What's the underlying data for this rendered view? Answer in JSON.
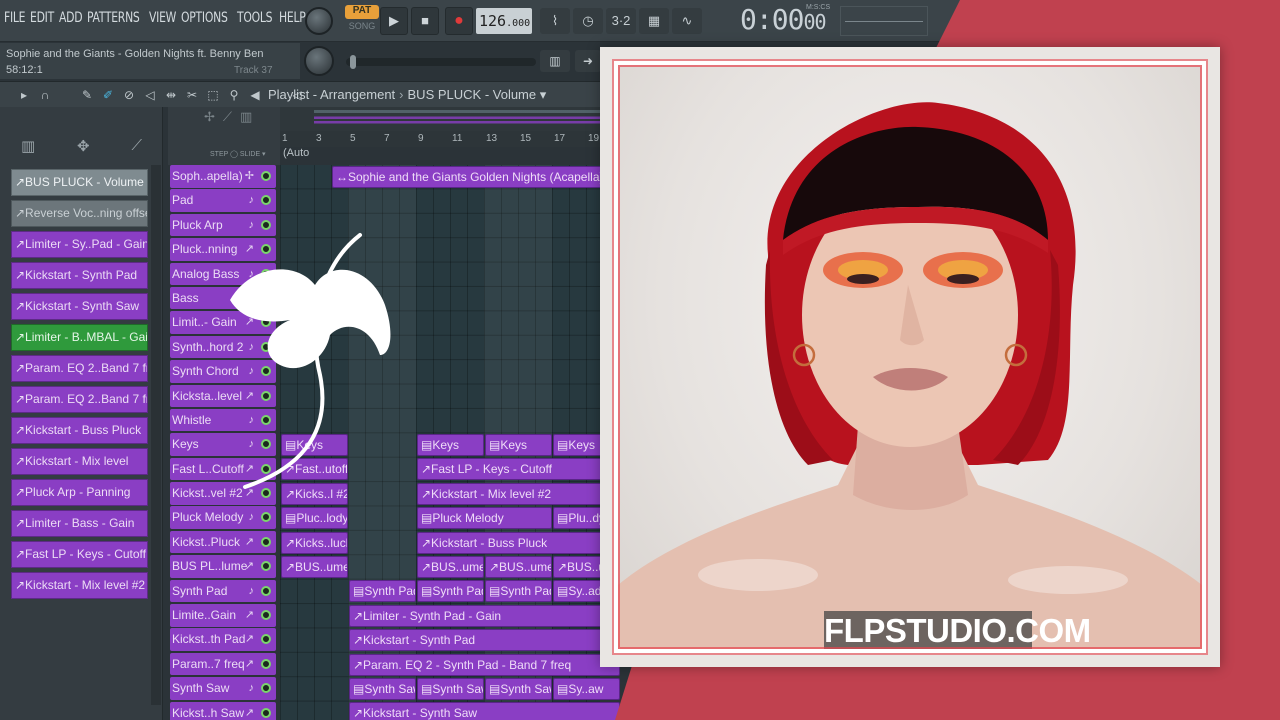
{
  "menu": [
    "FILE",
    "EDIT",
    "ADD",
    "PATTERNS",
    "VIEW",
    "OPTIONS",
    "TOOLS",
    "HELP"
  ],
  "transport": {
    "pat_label": "PAT",
    "song_label": "SONG",
    "play_icon": "play-icon",
    "stop_icon": "stop-icon",
    "record_icon": "record-icon",
    "tempo_main": "126",
    "tempo_frac": ".000",
    "clock": "0:00",
    "clock_frac": "00",
    "clock_label": "M:S:CS"
  },
  "toolbar_icons": [
    "snap-icon",
    "metronome-icon",
    "step-icon",
    "mixer-icon",
    "waveform-icon"
  ],
  "toolbar_glyphs": [
    "⌇",
    "◷",
    "3·2",
    "▦",
    "∿"
  ],
  "hint": {
    "title": "Sophie and the Giants - Golden Nights ft. Benny Ben",
    "time": "58:12:1",
    "track": "Track 37"
  },
  "breadcrumb": {
    "a": "Playlist - Arrangement",
    "sep": "›",
    "b": "BUS PLUCK - Volume",
    "c": "▾"
  },
  "picker": {
    "icons": [
      "▥",
      "✥",
      "⟋"
    ],
    "items": [
      {
        "label": "↗BUS PLUCK - Volume",
        "style": "sel"
      },
      {
        "label": "↗Reverse Voc..ning offset",
        "style": "gray"
      },
      {
        "label": "↗Limiter - Sy..Pad - Gain",
        "style": ""
      },
      {
        "label": "↗Kickstart - Synth Pad",
        "style": ""
      },
      {
        "label": "↗Kickstart - Synth Saw",
        "style": ""
      },
      {
        "label": "↗Limiter - B..MBAL - Gain",
        "style": "green"
      },
      {
        "label": "↗Param. EQ 2..Band 7 freq",
        "style": ""
      },
      {
        "label": "↗Param. EQ 2..Band 7 freq",
        "style": ""
      },
      {
        "label": "↗Kickstart - Buss Pluck",
        "style": ""
      },
      {
        "label": "↗Kickstart - Mix level",
        "style": ""
      },
      {
        "label": "↗Pluck Arp - Panning",
        "style": ""
      },
      {
        "label": "↗Limiter - Bass - Gain",
        "style": ""
      },
      {
        "label": "↗Fast LP - Keys - Cutoff",
        "style": ""
      },
      {
        "label": "↗Kickstart - Mix level #2",
        "style": ""
      }
    ]
  },
  "step_slide": "STEP ◯ SLIDE ▾",
  "tracks": [
    {
      "label": "Soph..apella)",
      "icon": "✢"
    },
    {
      "label": "Pad",
      "icon": "♪"
    },
    {
      "label": "Pluck Arp",
      "icon": "♪"
    },
    {
      "label": "Pluck..nning",
      "icon": "↗"
    },
    {
      "label": "Analog Bass",
      "icon": "♪"
    },
    {
      "label": "Bass",
      "icon": "♪"
    },
    {
      "label": "Limit..- Gain",
      "icon": "↗"
    },
    {
      "label": "Synth..hord 2",
      "icon": "♪"
    },
    {
      "label": "Synth Chord",
      "icon": "♪"
    },
    {
      "label": "Kicksta..level",
      "icon": "↗"
    },
    {
      "label": "Whistle",
      "icon": "♪"
    },
    {
      "label": "Keys",
      "icon": "♪"
    },
    {
      "label": "Fast L..Cutoff",
      "icon": "↗"
    },
    {
      "label": "Kickst..vel #2",
      "icon": "↗"
    },
    {
      "label": "Pluck Melody",
      "icon": "♪"
    },
    {
      "label": "Kickst..Pluck",
      "icon": "↗"
    },
    {
      "label": "BUS PL..lume",
      "icon": "↗"
    },
    {
      "label": "Synth Pad",
      "icon": "♪"
    },
    {
      "label": "Limite..Gain",
      "icon": "↗"
    },
    {
      "label": "Kickst..th Pad",
      "icon": "↗"
    },
    {
      "label": "Param..7 freq",
      "icon": "↗"
    },
    {
      "label": "Synth Saw",
      "icon": "♪"
    },
    {
      "label": "Kickst..h Saw",
      "icon": "↗"
    }
  ],
  "ruler": [
    "1",
    "3",
    "5",
    "7",
    "9",
    "11",
    "13",
    "15",
    "17",
    "19"
  ],
  "auto_label": "(Auto",
  "clips": [
    {
      "row": 0,
      "col": 3,
      "span": 16,
      "label": "↔Sophie and the Giants  Golden Nights (Acapella)"
    },
    {
      "row": 11,
      "col": 0,
      "span": 4,
      "label": "▤Keys"
    },
    {
      "row": 11,
      "col": 8,
      "span": 4,
      "label": "▤Keys"
    },
    {
      "row": 11,
      "col": 12,
      "span": 4,
      "label": "▤Keys"
    },
    {
      "row": 11,
      "col": 16,
      "span": 4,
      "label": "▤Keys"
    },
    {
      "row": 12,
      "col": 0,
      "span": 4,
      "label": "↗Fast..utoff"
    },
    {
      "row": 12,
      "col": 8,
      "span": 12,
      "label": "↗Fast LP - Keys - Cutoff"
    },
    {
      "row": 13,
      "col": 0,
      "span": 4,
      "label": "↗Kicks..l #2"
    },
    {
      "row": 13,
      "col": 8,
      "span": 12,
      "label": "↗Kickstart - Mix level #2"
    },
    {
      "row": 14,
      "col": 0,
      "span": 4,
      "label": "▤Pluc..lody"
    },
    {
      "row": 14,
      "col": 8,
      "span": 8,
      "label": "▤Pluck Melody"
    },
    {
      "row": 14,
      "col": 16,
      "span": 4,
      "label": "▤Plu..dy"
    },
    {
      "row": 15,
      "col": 0,
      "span": 4,
      "label": "↗Kicks..luck"
    },
    {
      "row": 15,
      "col": 8,
      "span": 12,
      "label": "↗Kickstart - Buss Pluck"
    },
    {
      "row": 16,
      "col": 0,
      "span": 4,
      "label": "↗BUS..ume"
    },
    {
      "row": 16,
      "col": 8,
      "span": 4,
      "label": "↗BUS..ume"
    },
    {
      "row": 16,
      "col": 12,
      "span": 4,
      "label": "↗BUS..ume"
    },
    {
      "row": 16,
      "col": 16,
      "span": 4,
      "label": "↗BUS..u"
    },
    {
      "row": 17,
      "col": 4,
      "span": 4,
      "label": "▤Synth Pad"
    },
    {
      "row": 17,
      "col": 8,
      "span": 4,
      "label": "▤Synth Pad"
    },
    {
      "row": 17,
      "col": 12,
      "span": 4,
      "label": "▤Synth Pad"
    },
    {
      "row": 17,
      "col": 16,
      "span": 4,
      "label": "▤Sy..ad"
    },
    {
      "row": 18,
      "col": 4,
      "span": 16,
      "label": "↗Limiter - Synth Pad - Gain"
    },
    {
      "row": 19,
      "col": 4,
      "span": 16,
      "label": "↗Kickstart - Synth Pad"
    },
    {
      "row": 20,
      "col": 4,
      "span": 16,
      "label": "↗Param. EQ 2 - Synth Pad - Band 7 freq"
    },
    {
      "row": 21,
      "col": 4,
      "span": 4,
      "label": "▤Synth Saw"
    },
    {
      "row": 21,
      "col": 8,
      "span": 4,
      "label": "▤Synth Saw"
    },
    {
      "row": 21,
      "col": 12,
      "span": 4,
      "label": "▤Synth Saw"
    },
    {
      "row": 21,
      "col": 16,
      "span": 4,
      "label": "▤Sy..aw"
    },
    {
      "row": 22,
      "col": 4,
      "span": 16,
      "label": "↗Kickstart - Synth Saw"
    }
  ],
  "watermark": "FLPSTUDIO.COM",
  "colors": {
    "clip_purple": "#8a3ec4",
    "accent_red": "#c0414f",
    "tempo_orange": "#e8a03a",
    "led_green": "#7bd66b"
  }
}
